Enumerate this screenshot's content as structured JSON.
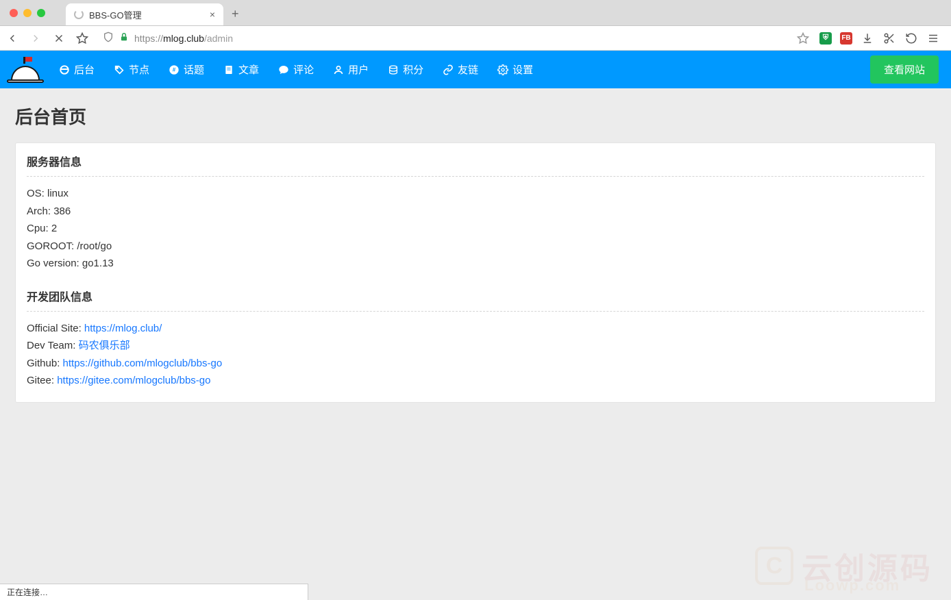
{
  "browser": {
    "tab_title": "BBS-GO管理",
    "new_tab_glyph": "+",
    "url_scheme": "https://",
    "url_host": "mlog.club",
    "url_path": "/admin",
    "status_text": "正在连接…"
  },
  "header": {
    "nav": [
      {
        "label": "后台",
        "icon": "dashboard"
      },
      {
        "label": "节点",
        "icon": "tag"
      },
      {
        "label": "话题",
        "icon": "hash"
      },
      {
        "label": "文章",
        "icon": "doc"
      },
      {
        "label": "评论",
        "icon": "comment"
      },
      {
        "label": "用户",
        "icon": "user"
      },
      {
        "label": "积分",
        "icon": "coin"
      },
      {
        "label": "友链",
        "icon": "link"
      },
      {
        "label": "设置",
        "icon": "gear"
      }
    ],
    "view_site_label": "查看网站"
  },
  "page": {
    "title": "后台首页",
    "server_section_title": "服务器信息",
    "server_info": [
      {
        "label": "OS:",
        "value": "linux"
      },
      {
        "label": "Arch:",
        "value": "386"
      },
      {
        "label": "Cpu:",
        "value": "2"
      },
      {
        "label": "GOROOT:",
        "value": "/root/go"
      },
      {
        "label": "Go version:",
        "value": "go1.13"
      }
    ],
    "team_section_title": "开发团队信息",
    "team_info": [
      {
        "label": "Official Site:",
        "link": "https://mlog.club/"
      },
      {
        "label": "Dev Team:",
        "link": "码农俱乐部"
      },
      {
        "label": "Github:",
        "link": "https://github.com/mlogclub/bbs-go"
      },
      {
        "label": "Gitee:",
        "link": "https://gitee.com/mlogclub/bbs-go"
      }
    ]
  },
  "watermark": {
    "cn": "云创源码",
    "en": "Loowp.com",
    "icon": "C"
  }
}
